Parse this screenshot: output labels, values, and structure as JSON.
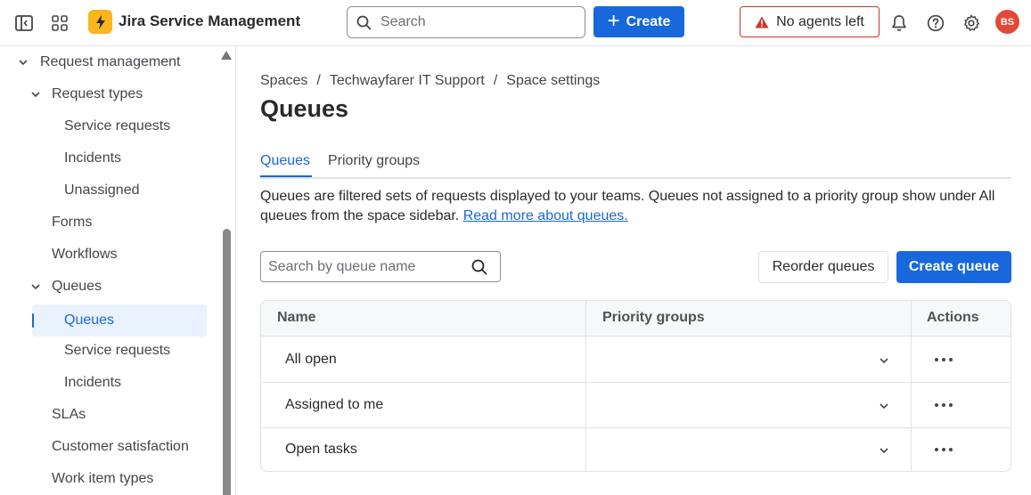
{
  "topbar": {
    "product_name": "Jira Service Management",
    "search_placeholder": "Search",
    "create_label": "Create",
    "agents_label": "No agents left",
    "avatar_initials": "BS"
  },
  "sidebar": {
    "items": [
      {
        "label": "Request management",
        "level": 0,
        "expanded": true
      },
      {
        "label": "Request types",
        "level": 1,
        "expanded": true
      },
      {
        "label": "Service requests",
        "level": 2
      },
      {
        "label": "Incidents",
        "level": 2
      },
      {
        "label": "Unassigned",
        "level": 2
      },
      {
        "label": "Forms",
        "level": 1
      },
      {
        "label": "Workflows",
        "level": 1
      },
      {
        "label": "Queues",
        "level": 1,
        "expanded": true
      },
      {
        "label": "Queues",
        "level": 2,
        "selected": true
      },
      {
        "label": "Service requests",
        "level": 2
      },
      {
        "label": "Incidents",
        "level": 2
      },
      {
        "label": "SLAs",
        "level": 1
      },
      {
        "label": "Customer satisfaction",
        "level": 1
      },
      {
        "label": "Work item types",
        "level": 1
      }
    ]
  },
  "breadcrumb": [
    "Spaces",
    "Techwayfarer IT Support",
    "Space settings"
  ],
  "page_title": "Queues",
  "tabs": [
    {
      "label": "Queues",
      "active": true
    },
    {
      "label": "Priority groups",
      "active": false
    }
  ],
  "description": {
    "text": "Queues are filtered sets of requests displayed to your teams. Queues not assigned to a priority group show under All queues from the space sidebar. ",
    "link": "Read more about queues."
  },
  "queue_search_placeholder": "Search by queue name",
  "buttons": {
    "reorder": "Reorder queues",
    "create_queue": "Create queue"
  },
  "table": {
    "headers": [
      "Name",
      "Priority groups",
      "Actions"
    ],
    "rows": [
      {
        "name": "All open",
        "priority_group": ""
      },
      {
        "name": "Assigned to me",
        "priority_group": ""
      },
      {
        "name": "Open tasks",
        "priority_group": ""
      }
    ]
  },
  "colors": {
    "accent": "#1868db",
    "warning": "#c9372c",
    "logo": "#fcb51b",
    "avatar": "#e34935"
  }
}
